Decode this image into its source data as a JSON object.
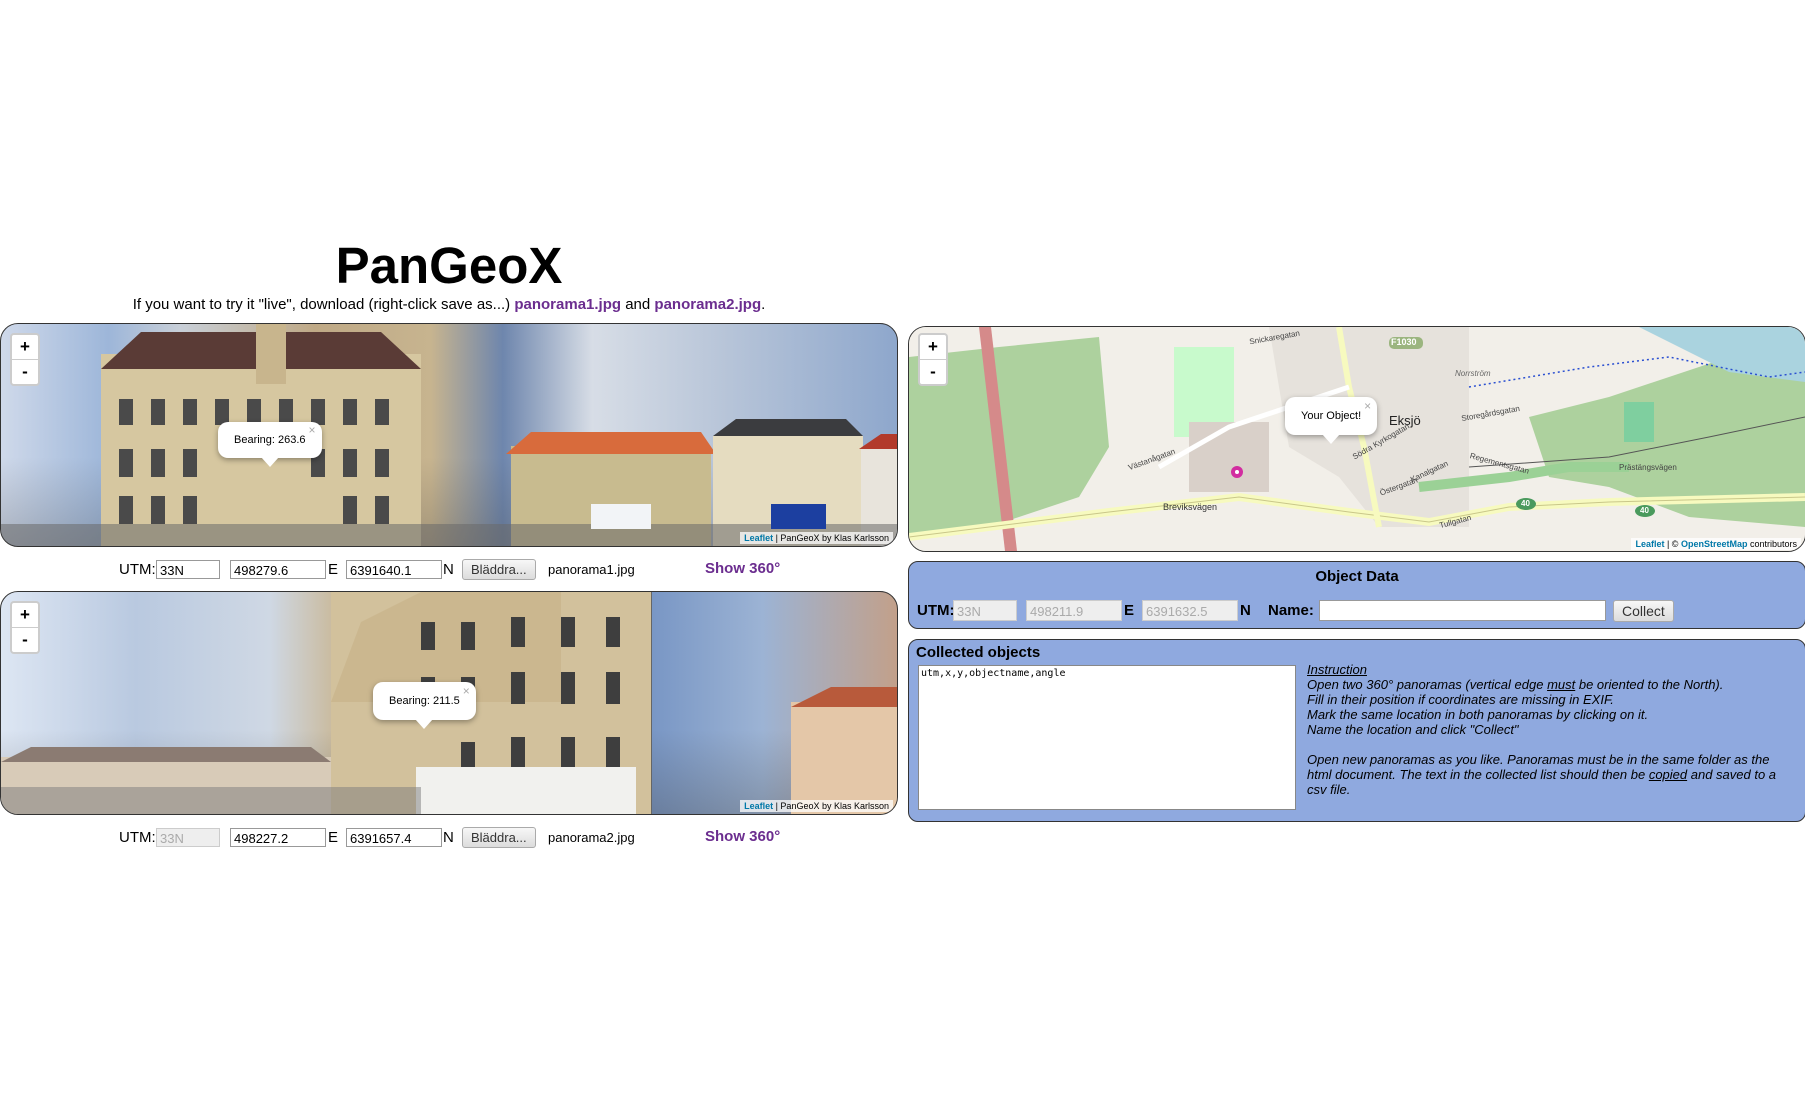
{
  "header": {
    "title": "PanGeoX",
    "intro_text": "If you want to try it \"live\", download (right-click save as...)",
    "link1": "panorama1.jpg",
    "and_text": "and",
    "link2": "panorama2.jpg",
    "period": "."
  },
  "zoom": {
    "in": "+",
    "out": "-"
  },
  "panorama1": {
    "popup": "Bearing: 263.6",
    "close": "×",
    "attrib_link": "Leaflet",
    "attrib_text": " | PanGeoX by Klas Karlsson",
    "utm_label": "UTM:",
    "zone": "33N",
    "easting": "498279.6",
    "e_label": "E",
    "northing": "6391640.1",
    "n_label": "N",
    "browse": "Bläddra...",
    "filename": "panorama1.jpg",
    "show360": "Show 360°"
  },
  "panorama2": {
    "popup": "Bearing: 211.5",
    "close": "×",
    "attrib_link": "Leaflet",
    "attrib_text": " | PanGeoX by Klas Karlsson",
    "utm_label": "UTM:",
    "zone": "33N",
    "easting": "498227.2",
    "e_label": "E",
    "northing": "6391657.4",
    "n_label": "N",
    "browse": "Bläddra...",
    "filename": "panorama2.jpg",
    "show360": "Show 360°"
  },
  "map": {
    "popup": "Your Object!",
    "close": "×",
    "town": "Eksjö",
    "road_label": "F1030",
    "roads": [
      "Breviksvägen",
      "Västanågatan",
      "Norrström",
      "Storegårdsgatan",
      "Prästängsvägen",
      "Regementsgatan",
      "Södra Kyrkogatan",
      "Tullgatan",
      "Kanalgatan",
      "Östergatan",
      "Snickaregatan"
    ],
    "route40a": "40",
    "route40b": "40",
    "attrib_link1": "Leaflet",
    "attrib_mid": " | © ",
    "attrib_link2": "OpenStreetMap",
    "attrib_end": " contributors",
    "colors": {
      "forest": "#add19e",
      "park": "#c8facc",
      "water": "#aad3df",
      "residential": "#e0dfdf",
      "primary_road": "#fcd6a4",
      "railway": "#d58a8a"
    }
  },
  "object_data": {
    "heading": "Object Data",
    "utm_label": "UTM:",
    "zone": "33N",
    "easting": "498211.9",
    "e_label": "E",
    "northing": "6391632.5",
    "n_label": "N",
    "name_label": "Name:",
    "name_value": "",
    "collect": "Collect"
  },
  "collected": {
    "heading": "Collected objects",
    "textarea": "utm,x,y,objectname,angle",
    "instruction_title": "Instruction",
    "line1a": "Open two 360° panoramas (vertical edge ",
    "line1b": "must",
    "line1c": " be oriented to the North).",
    "line2": "Fill in their position if coordinates are missing in EXIF.",
    "line3": "Mark the same location in both panoramas by clicking on it.",
    "line4": "Name the location and click \"Collect\"",
    "line5a": "Open new panoramas as you like. Panoramas must be in the same folder as the html document. The text in the collected list should then be ",
    "line5b": "copied",
    "line5c": " and saved to a csv file."
  }
}
